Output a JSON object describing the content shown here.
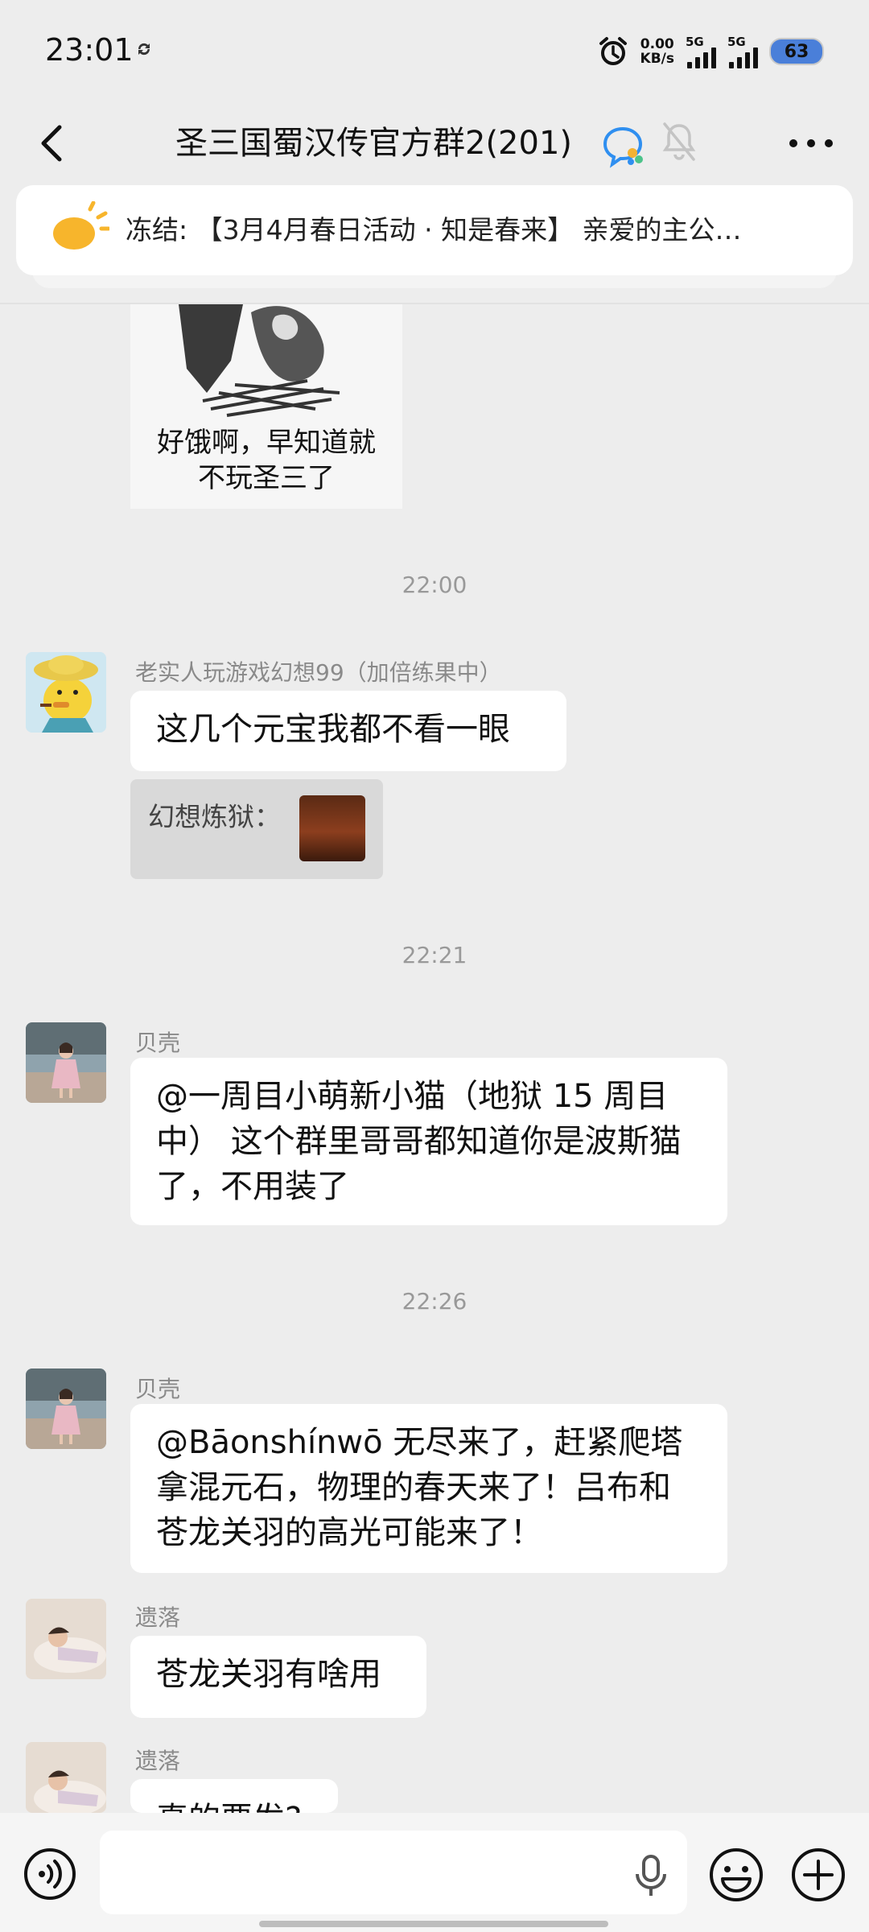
{
  "status_bar": {
    "time": "23:01",
    "net_speed_value": "0.00",
    "net_speed_unit": "KB/s",
    "sim1_label": "5G",
    "sim2_label": "5G",
    "battery": "63"
  },
  "header": {
    "title": "圣三国蜀汉传官方群2(201)"
  },
  "announcement": {
    "text": "冻结: 【3月4月春日活动 · 知是春来】 亲爱的主公…"
  },
  "messages": {
    "meme_caption_line1": "好饿啊，早知道就",
    "meme_caption_line2": "不玩圣三了",
    "time1": "22:00",
    "sender1": "老实人玩游戏幻想99（加倍练果中）",
    "text1": "这几个元宝我都不看一眼",
    "card_label": "幻想炼狱：",
    "time2": "22:21",
    "sender2": "贝壳",
    "text2": "@一周目小萌新小猫（地狱 15 周目中） 这个群里哥哥都知道你是波斯猫了，不用装了",
    "time3": "22:26",
    "sender3": "贝壳",
    "text3": "@Bāonshínwō 无尽来了，赶紧爬塔拿混元石，物理的春天来了！吕布和苍龙关羽的高光可能来了！",
    "sender4": "遗落",
    "text4": "苍龙关羽有啥用",
    "sender5": "遗落",
    "text5": "真的要发?"
  },
  "input_bar": {
    "placeholder": ""
  }
}
